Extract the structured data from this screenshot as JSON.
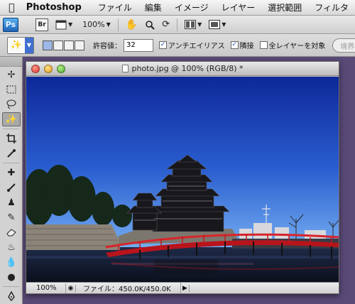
{
  "menubar": {
    "apple_icon": "apple-icon",
    "app_name": "Photoshop",
    "items": [
      "ファイル",
      "編集",
      "イメージ",
      "レイヤー",
      "選択範囲",
      "フィルタ"
    ]
  },
  "appbar": {
    "ps_label": "Ps",
    "br_label": "Br",
    "zoom_value": "100%"
  },
  "options": {
    "tolerance_label": "許容値：",
    "tolerance_value": "32",
    "antialias_label": "アンチエイリアス",
    "antialias_checked": true,
    "contiguous_label": "隣接",
    "contiguous_checked": true,
    "sample_all_label": "全レイヤーを対象",
    "sample_all_checked": false,
    "refine_edge_label": "境界"
  },
  "document": {
    "title": "photo.jpg @ 100% (RGB/8) *",
    "zoom": "100%",
    "file_info": "ファイル：450.0K/450.0K",
    "photo_description": "blue sky over black castle and red bridge"
  },
  "colors": {
    "sky_top": "#0f2a9c",
    "sky_bottom": "#6ea6ee",
    "bridge_red": "#c0181f",
    "castle": "#1a1a1e",
    "accent_blue": "#3f6fd0"
  }
}
